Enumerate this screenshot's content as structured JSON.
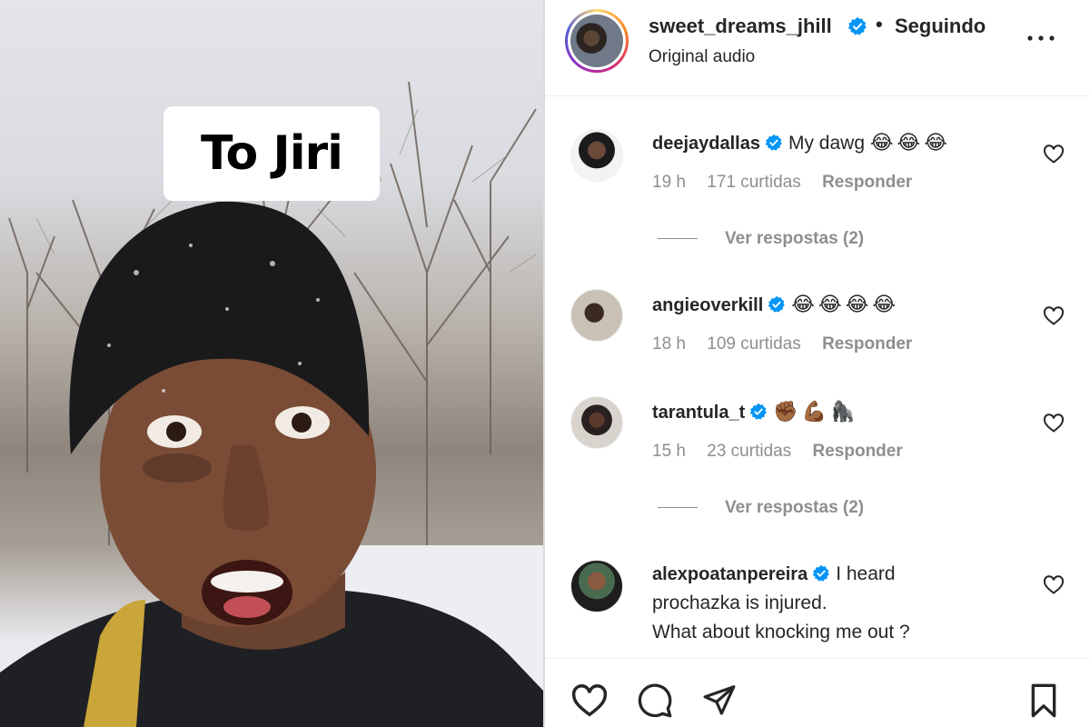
{
  "media": {
    "caption": "To Jiri"
  },
  "post_header": {
    "username": "sweet_dreams_jhill",
    "separator": "•",
    "follow_status": "Seguindo",
    "audio": "Original audio"
  },
  "comments": [
    {
      "username": "deejaydallas",
      "verified": true,
      "text": "My dawg",
      "emoji": "😂😂😂",
      "time": "19 h",
      "likes": "171 curtidas",
      "reply_label": "Responder",
      "view_replies": "Ver respostas (2)"
    },
    {
      "username": "angieoverkill",
      "verified": true,
      "text": "",
      "emoji": "😂😂😂😂",
      "time": "18 h",
      "likes": "109 curtidas",
      "reply_label": "Responder"
    },
    {
      "username": "tarantula_t",
      "verified": true,
      "text": "",
      "emoji": "✊🏾💪🏾🦍",
      "time": "15 h",
      "likes": "23 curtidas",
      "reply_label": "Responder",
      "view_replies": "Ver respostas (2)"
    },
    {
      "username": "alexpoatanpereira",
      "verified": true,
      "text_line1": "I heard",
      "text_line2": "prochazka is injured.",
      "text_line3": "What about knocking me out ?"
    }
  ],
  "actions": {
    "like": "heart-icon",
    "comment": "comment-icon",
    "share": "share-icon",
    "save": "bookmark-icon"
  },
  "colors": {
    "verified": "#0095f6",
    "text": "#262626",
    "muted": "#8e8e8e"
  }
}
